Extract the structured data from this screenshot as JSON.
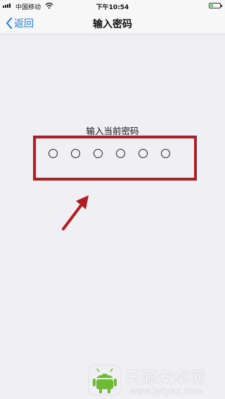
{
  "status_bar": {
    "carrier": "中国移动",
    "time": "下午10:54",
    "battery_level": 0.3
  },
  "nav_bar": {
    "back_label": "返回",
    "title": "输入密码"
  },
  "passcode": {
    "prompt": "输入当前密码",
    "digit_count": 6,
    "entered_count": 0
  },
  "annotation": {
    "highlight_color": "#b01f24",
    "arrow_color": "#b01f24"
  },
  "watermark": {
    "title": "天源安卓网",
    "url": "www.jytyaz.com"
  },
  "icons": [
    "signal-icon",
    "wifi-icon",
    "battery-icon",
    "chevron-left-icon",
    "arrow-annotation-icon",
    "android-logo-icon"
  ]
}
